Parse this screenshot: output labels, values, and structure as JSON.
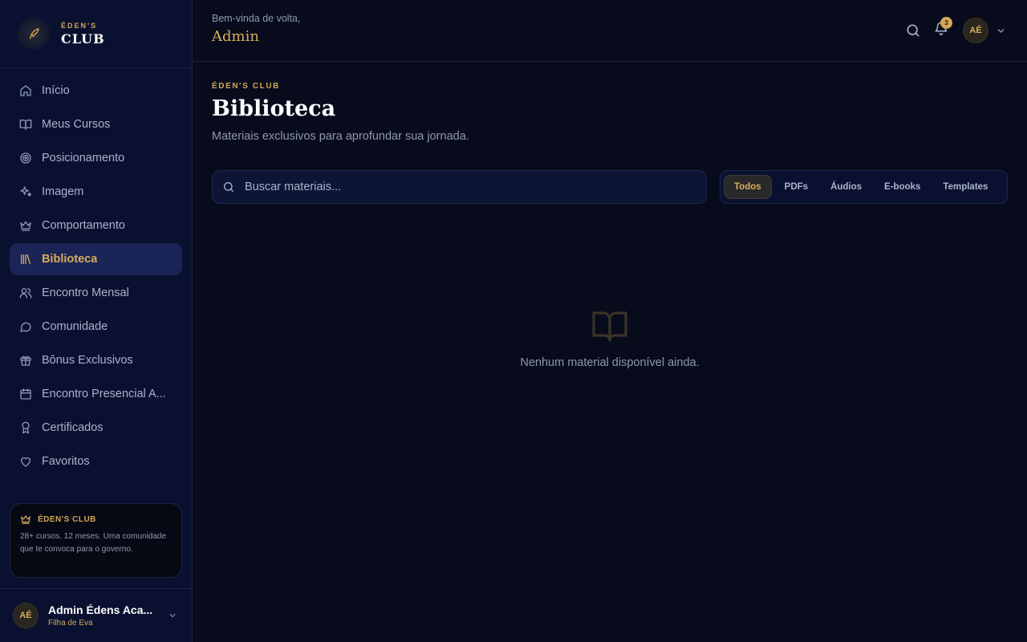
{
  "brand": {
    "top": "ÉDEN'S",
    "bottom": "CLUB"
  },
  "nav": {
    "items": [
      {
        "label": "Início",
        "icon": "home-icon",
        "active": false
      },
      {
        "label": "Meus Cursos",
        "icon": "book-open-icon",
        "active": false
      },
      {
        "label": "Posicionamento",
        "icon": "target-icon",
        "active": false
      },
      {
        "label": "Imagem",
        "icon": "sparkles-icon",
        "active": false
      },
      {
        "label": "Comportamento",
        "icon": "crown-icon",
        "active": false
      },
      {
        "label": "Biblioteca",
        "icon": "library-icon",
        "active": true
      },
      {
        "label": "Encontro Mensal",
        "icon": "users-icon",
        "active": false
      },
      {
        "label": "Comunidade",
        "icon": "chat-bubble-icon",
        "active": false
      },
      {
        "label": "Bônus Exclusivos",
        "icon": "gift-icon",
        "active": false
      },
      {
        "label": "Encontro Presencial A...",
        "icon": "calendar-icon",
        "active": false
      },
      {
        "label": "Certificados",
        "icon": "award-icon",
        "active": false
      },
      {
        "label": "Favoritos",
        "icon": "heart-icon",
        "active": false
      }
    ]
  },
  "promo": {
    "title": "ÉDEN'S CLUB",
    "text": "28+ cursos. 12 meses. Uma comunidade que te convoca para o governo."
  },
  "user": {
    "initials": "AÉ",
    "name": "Admin Édens Aca...",
    "role": "Filha de Eva"
  },
  "header": {
    "greeting": "Bem-vinda de volta,",
    "name": "Admin",
    "notification_count": "3",
    "avatar_initials": "AÉ"
  },
  "page": {
    "eyebrow": "ÉDEN'S CLUB",
    "title": "Biblioteca",
    "subtitle": "Materiais exclusivos para aprofundar sua jornada."
  },
  "search": {
    "placeholder": "Buscar materiais..."
  },
  "filters": [
    "Todos",
    "PDFs",
    "Áudios",
    "E-books",
    "Templates"
  ],
  "active_filter": "Todos",
  "empty": {
    "text": "Nenhum material disponível ainda."
  },
  "colors": {
    "accent": "#d9ad5b",
    "background": "#070b1c",
    "sidebar": "#0a1130",
    "active_nav": "#1a2456"
  }
}
